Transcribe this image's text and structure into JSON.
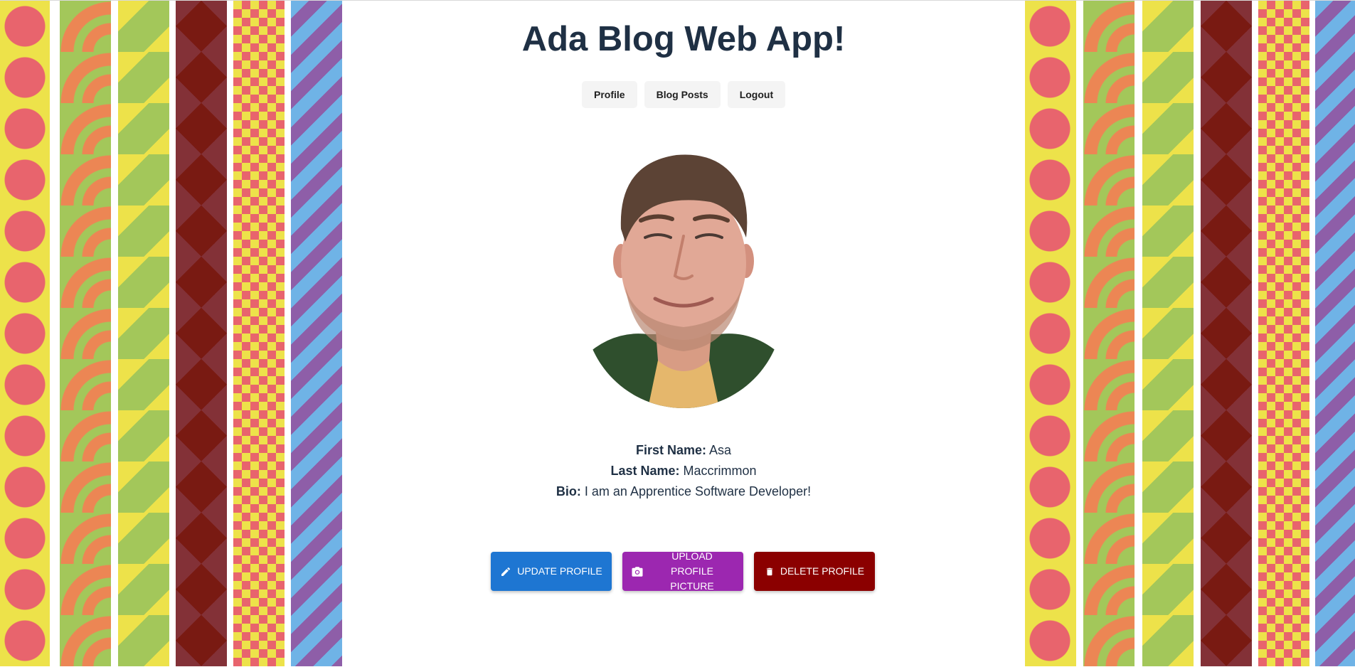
{
  "header": {
    "title": "Ada Blog Web App!"
  },
  "nav": {
    "items": [
      {
        "label": "Profile"
      },
      {
        "label": "Blog Posts"
      },
      {
        "label": "Logout"
      }
    ]
  },
  "profile": {
    "first_name_label": "First Name:",
    "first_name": "Asa",
    "last_name_label": "Last Name:",
    "last_name": "Maccrimmon",
    "bio_label": "Bio:",
    "bio": "I am an Apprentice Software Developer!"
  },
  "actions": {
    "update_label": "UPDATE PROFILE",
    "upload_label": "UPLOAD PROFILE PICTURE",
    "delete_label": "DELETE PROFILE"
  },
  "icons": {
    "update": "pencil-icon",
    "upload": "camera-icon",
    "delete": "trash-icon"
  },
  "colors": {
    "title": "#1f3044",
    "update_button": "#1e76d2",
    "upload_button": "#9c27b0",
    "delete_button": "#8b0000"
  }
}
